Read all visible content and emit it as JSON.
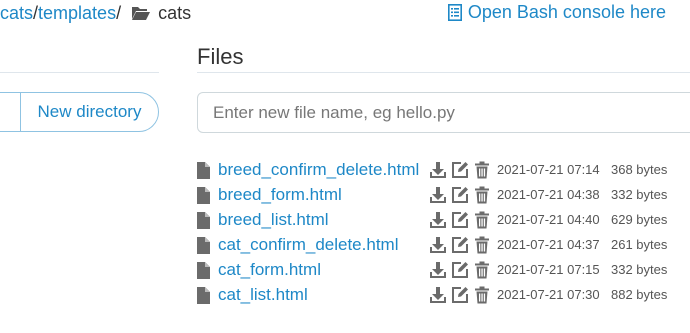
{
  "breadcrumb": {
    "parts": [
      {
        "label": "cats"
      },
      {
        "label": "templates"
      }
    ],
    "separator": "/",
    "current": "cats",
    "folder_icon": "folder-open-icon"
  },
  "bash_link": {
    "label": "Open Bash console here",
    "icon": "console-list-icon"
  },
  "files_panel": {
    "title": "Files",
    "input_placeholder": "Enter new file name, eg hello.py"
  },
  "directories_panel": {
    "new_directory_label": "New directory"
  },
  "files": [
    {
      "name": "breed_confirm_delete.html",
      "date": "2021-07-21 07:14",
      "size": "368 bytes"
    },
    {
      "name": "breed_form.html",
      "date": "2021-07-21 04:38",
      "size": "332 bytes"
    },
    {
      "name": "breed_list.html",
      "date": "2021-07-21 04:40",
      "size": "629 bytes"
    },
    {
      "name": "cat_confirm_delete.html",
      "date": "2021-07-21 04:37",
      "size": "261 bytes"
    },
    {
      "name": "cat_form.html",
      "date": "2021-07-21 07:15",
      "size": "332 bytes"
    },
    {
      "name": "cat_list.html",
      "date": "2021-07-21 07:30",
      "size": "882 bytes"
    }
  ],
  "row_icons": {
    "file": "file-icon",
    "download": "download-icon",
    "edit": "edit-icon",
    "delete": "trash-icon"
  },
  "colors": {
    "link": "#1e88c7",
    "icon": "#6b6b6b",
    "text": "#333333"
  }
}
